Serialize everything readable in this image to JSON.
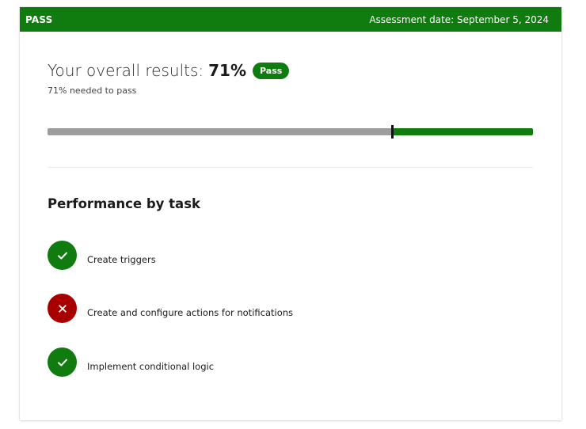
{
  "header": {
    "status": "PASS",
    "date_label": "Assessment date:",
    "date_value": "September 5, 2024",
    "color": "#107c10"
  },
  "results": {
    "label": "Your overall results:",
    "score": "71%",
    "badge": "Pass",
    "needed": "71% needed to pass",
    "score_fraction": 0.71,
    "pass_threshold_fraction": 0.71
  },
  "performance": {
    "title": "Performance by task",
    "tasks": [
      {
        "label": "Create triggers",
        "status": "pass",
        "icon": "check-icon"
      },
      {
        "label": "Create and configure actions for notifications",
        "status": "fail",
        "icon": "cross-icon"
      },
      {
        "label": "Implement conditional logic",
        "status": "pass",
        "icon": "check-icon"
      }
    ]
  },
  "colors": {
    "pass": "#107c10",
    "fail": "#a80000",
    "track": "#9d9d9d"
  }
}
